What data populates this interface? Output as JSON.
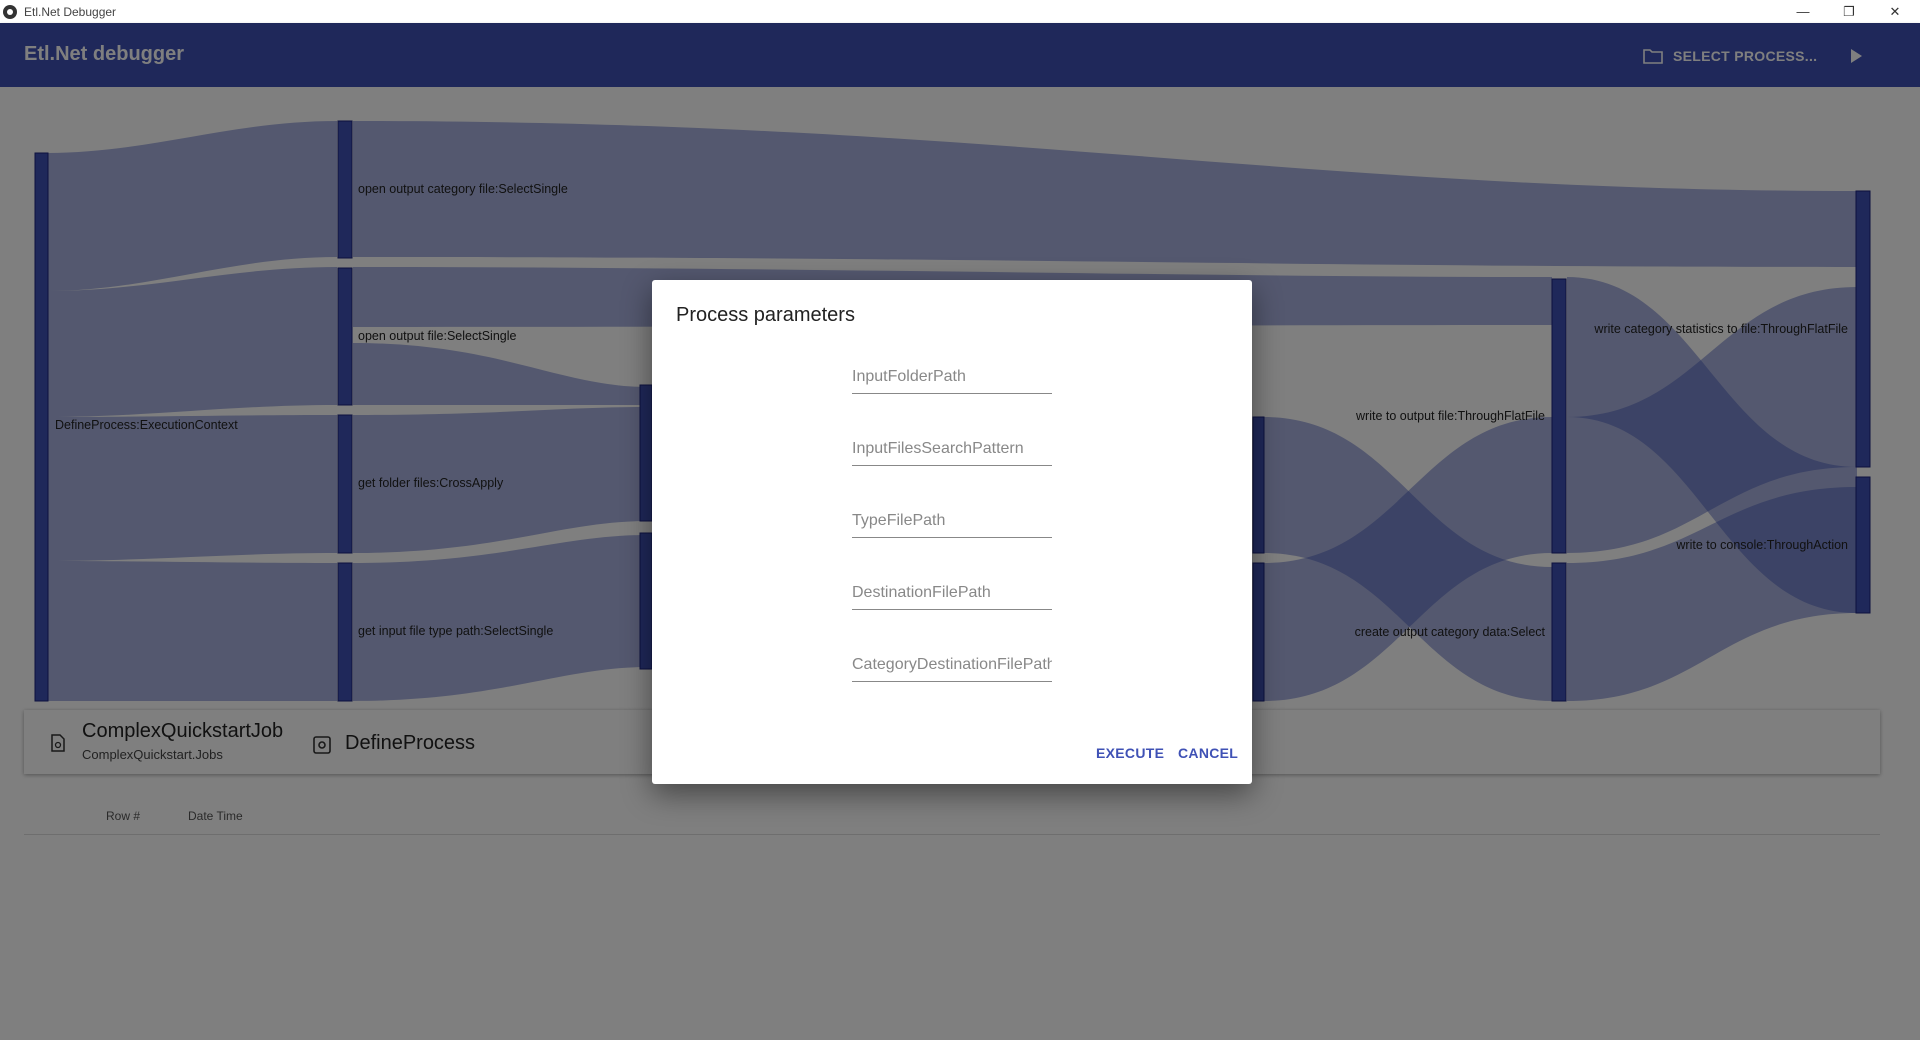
{
  "window": {
    "title": "Etl.Net Debugger",
    "controls": {
      "minimize": "—",
      "maximize": "❐",
      "close": "✕"
    }
  },
  "appbar": {
    "title": "Etl.Net debugger",
    "select_process_label": "SELECT PROCESS...",
    "icons": {
      "select": "folder-icon",
      "run": "play-icon"
    }
  },
  "colors": {
    "primary": "#3f51b5",
    "node": "#3f51b5",
    "link": "#3f51b5"
  },
  "sankey": {
    "nodes": [
      {
        "label": "DefineProcess:ExecutionContext"
      },
      {
        "label": "open output category file:SelectSingle"
      },
      {
        "label": "open output file:SelectSingle"
      },
      {
        "label": "get folder files:CrossApply"
      },
      {
        "label": "get input file type path:SelectSingle"
      },
      {
        "label": "write to output file:ThroughFlatFile"
      },
      {
        "label": "create output category data:Select"
      },
      {
        "label": "write category statistics to file:ThroughFlatFile"
      },
      {
        "label": "write to console:ThroughAction"
      }
    ]
  },
  "job": {
    "name": "ComplexQuickstartJob",
    "namespace": "ComplexQuickstart.Jobs",
    "process": "DefineProcess",
    "icons": {
      "job": "file-code-icon",
      "process": "gear-box-icon"
    }
  },
  "grid": {
    "columns": [
      "Row #",
      "Date Time"
    ]
  },
  "dialog": {
    "title": "Process parameters",
    "fields": [
      {
        "placeholder": "InputFolderPath",
        "value": ""
      },
      {
        "placeholder": "InputFilesSearchPattern",
        "value": ""
      },
      {
        "placeholder": "TypeFilePath",
        "value": ""
      },
      {
        "placeholder": "DestinationFilePath",
        "value": ""
      },
      {
        "placeholder": "CategoryDestinationFilePath",
        "value": ""
      }
    ],
    "execute_label": "EXECUTE",
    "cancel_label": "CANCEL"
  }
}
